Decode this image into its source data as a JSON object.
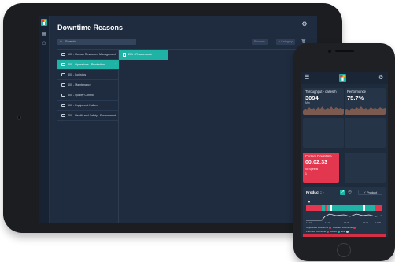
{
  "tablet": {
    "title": "Downtime Reasons",
    "search_placeholder": "Search",
    "buttons": {
      "rename": "Rename",
      "new_category": "+ Category"
    },
    "categories": [
      {
        "label": "100 - Human Resources Management",
        "selected": false
      },
      {
        "label": "200 - Operations - Production",
        "selected": true
      },
      {
        "label": "300 - Logistics",
        "selected": false
      },
      {
        "label": "400 - Maintenance",
        "selected": false
      },
      {
        "label": "500 - Quality Control",
        "selected": false
      },
      {
        "label": "600 - Equipment Failure",
        "selected": false
      },
      {
        "label": "700 - Health and Safety - Environment",
        "selected": false
      }
    ],
    "subitems": [
      {
        "label": "201 - Reason code"
      }
    ]
  },
  "phone": {
    "kpi_throughput": {
      "label": "Throughput - cases/h",
      "value": "3094",
      "sub": "Min"
    },
    "kpi_performance": {
      "label": "Performance",
      "value": "75.7%"
    },
    "current_downtime": {
      "label": "Current Downtime",
      "value": "00:02:33",
      "sub": "No speeds",
      "count": "1"
    },
    "product": {
      "title": "Product : -",
      "button": "Product",
      "ticks": [
        "14:15",
        "14:20",
        "14:25",
        "14:30",
        "14:35"
      ],
      "legend": {
        "unjustified": "Unjustified Downtime",
        "justified": "Justified Downtime",
        "planned": "Planned Downtime",
        "active": "Active",
        "idle": "Idle"
      }
    }
  },
  "colors": {
    "accent": "#1fb3a6",
    "alarm": "#e2374f",
    "screen_bg": "#1f2c3f"
  }
}
